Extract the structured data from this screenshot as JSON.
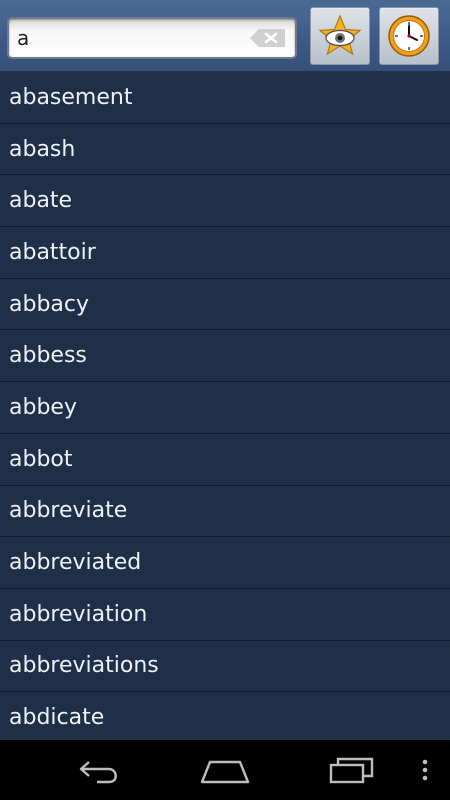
{
  "search": {
    "value": "a"
  },
  "toolbar": {
    "favorites_icon": "star-eye-icon",
    "history_icon": "clock-icon"
  },
  "words": [
    "abasement",
    "abash",
    "abate",
    "abattoir",
    "abbacy",
    "abbess",
    "abbey",
    "abbot",
    "abbreviate",
    "abbreviated",
    "abbreviation",
    "abbreviations",
    "abdicate"
  ],
  "colors": {
    "topbar": "#3e5c88",
    "list_bg": "#1f2f48",
    "text": "#eef2f7",
    "star": "#f4b324",
    "clock": "#f0a020"
  },
  "nav_icons": [
    "back-icon",
    "home-icon",
    "recent-apps-icon",
    "overflow-menu-icon"
  ]
}
